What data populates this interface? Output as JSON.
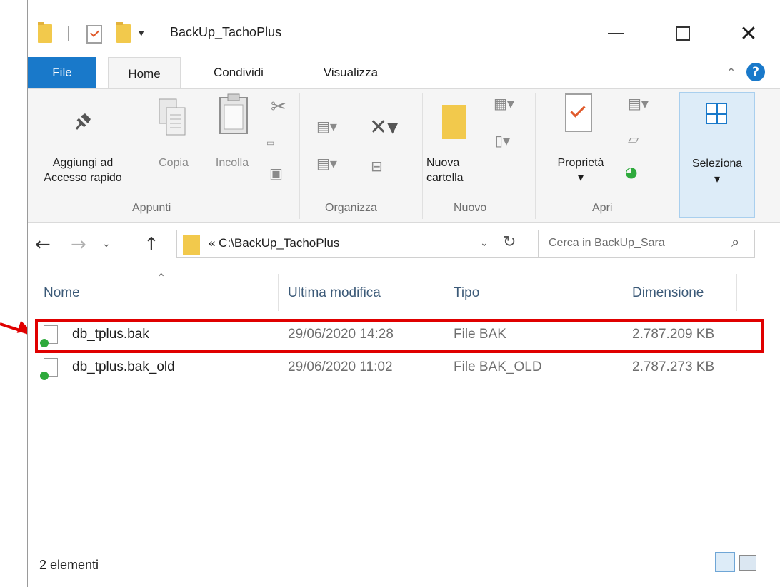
{
  "window": {
    "title": "BackUp_TachoPlus",
    "quick_access_arrow": "▾"
  },
  "tabs": [
    {
      "label": "File"
    },
    {
      "label": "Home"
    },
    {
      "label": "Condividi"
    },
    {
      "label": "Visualizza"
    }
  ],
  "ribbon": {
    "pin": {
      "label_line1": "Aggiungi ad",
      "label_line2": "Accesso rapido"
    },
    "copy": {
      "label": "Copia"
    },
    "paste": {
      "label": "Incolla"
    },
    "group_clipboard": "Appunti",
    "group_organize": "Organizza",
    "new_folder": {
      "label_line1": "Nuova",
      "label_line2": "cartella"
    },
    "group_new": "Nuovo",
    "properties": {
      "label": "Proprietà",
      "caret": "▾"
    },
    "group_open": "Apri",
    "select": {
      "label": "Seleziona",
      "caret": "▾"
    }
  },
  "navigation": {
    "address": "« C:\\BackUp_TachoPlus",
    "search_placeholder": "Cerca in BackUp_Sara"
  },
  "columns": [
    "Nome",
    "Ultima modifica",
    "Tipo",
    "Dimensione"
  ],
  "files": [
    {
      "name": "db_tplus.bak",
      "modified": "29/06/2020 14:28",
      "type": "File BAK",
      "size": "2.787.209 KB",
      "highlighted": true
    },
    {
      "name": "db_tplus.bak_old",
      "modified": "29/06/2020 11:02",
      "type": "File BAK_OLD",
      "size": "2.787.273 KB",
      "highlighted": false
    }
  ],
  "status": {
    "item_count": "2 elementi"
  },
  "colors": {
    "accent": "#1979ca",
    "highlight": "#e00000",
    "folder": "#f2c94c"
  }
}
